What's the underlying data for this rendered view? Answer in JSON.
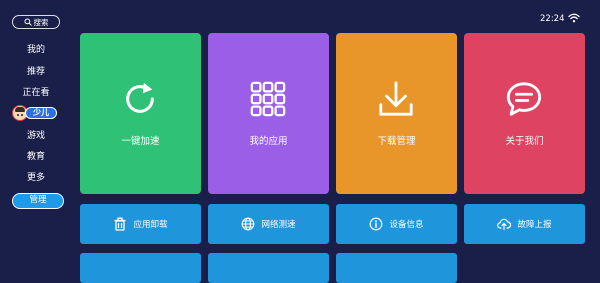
{
  "sidebar": {
    "search_label": "搜索",
    "items": [
      "我的",
      "推荐",
      "正在看"
    ],
    "kids_label": "少儿",
    "items_after": [
      "游戏",
      "教育",
      "更多"
    ],
    "active_item": "管理"
  },
  "status": {
    "time": "22:24"
  },
  "tiles": [
    {
      "label": "一键加速",
      "color": "#2fc276",
      "icon": "refresh-icon"
    },
    {
      "label": "我的应用",
      "color": "#9a5fe6",
      "icon": "grid-icon"
    },
    {
      "label": "下载管理",
      "color": "#e8962a",
      "icon": "download-icon"
    },
    {
      "label": "关于我们",
      "color": "#de4462",
      "icon": "chat-icon"
    }
  ],
  "buttons": [
    {
      "label": "应用卸载",
      "icon": "trash-icon"
    },
    {
      "label": "网络测速",
      "icon": "globe-icon"
    },
    {
      "label": "设备信息",
      "icon": "info-icon"
    },
    {
      "label": "故障上报",
      "icon": "upload-icon"
    }
  ],
  "colors": {
    "background": "#1a1f4a",
    "button": "#1f95dc",
    "active": "#1e9ae8"
  }
}
